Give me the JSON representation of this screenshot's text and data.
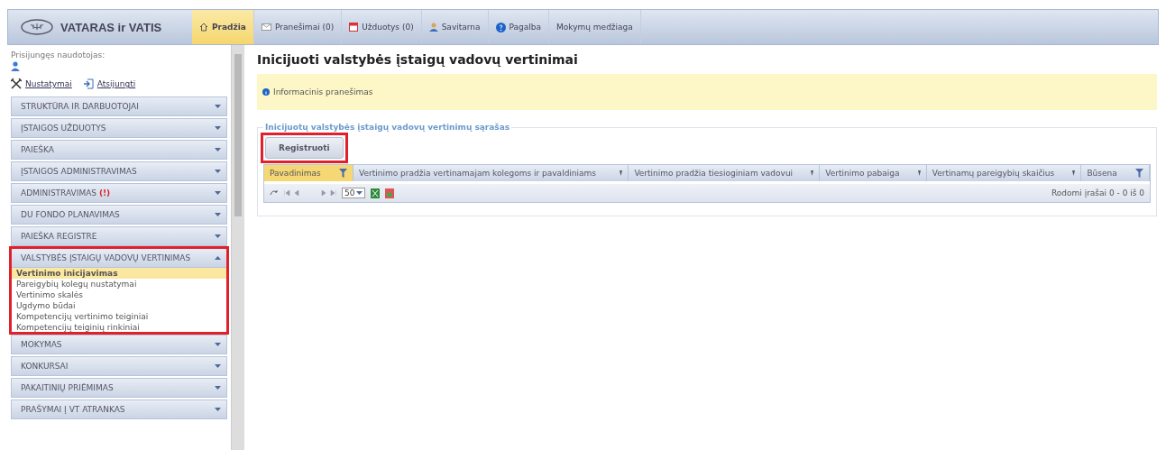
{
  "app": {
    "logo_text": "VATARAS ir VATIS"
  },
  "nav_tabs": [
    {
      "label": "Pradžia",
      "kind": "home",
      "selected": true
    },
    {
      "label": "Pranešimai (0)",
      "kind": "mail",
      "selected": false
    },
    {
      "label": "Užduotys (0)",
      "kind": "calendar",
      "selected": false
    },
    {
      "label": "Savitarna",
      "kind": "user",
      "selected": false
    },
    {
      "label": "Pagalba",
      "kind": "help",
      "selected": false
    },
    {
      "label": "Mokymų medžiaga",
      "kind": "plain",
      "selected": false
    }
  ],
  "user_panel": {
    "label": "Prisijungęs naudotojas:",
    "links": [
      {
        "label": "Nustatymai",
        "kind": "tools"
      },
      {
        "label": "Atsijungti",
        "kind": "logout"
      }
    ]
  },
  "sidebar": {
    "items": [
      {
        "label": "STRUKTŪRA IR DARBUOTOJAI",
        "expanded": false
      },
      {
        "label": "ĮSTAIGOS UŽDUOTYS",
        "expanded": false
      },
      {
        "label": "PAIEŠKA",
        "expanded": false
      },
      {
        "label": "ĮSTAIGOS ADMINISTRAVIMAS",
        "expanded": false
      },
      {
        "label": "ADMINISTRAVIMAS",
        "badge": "(!)",
        "expanded": false
      },
      {
        "label": "DU FONDO PLANAVIMAS",
        "expanded": false
      },
      {
        "label": "PAIEŠKA REGISTRE",
        "expanded": false
      },
      {
        "label": "VALSTYBĖS ĮSTAIGŲ VADOVŲ VERTINIMAS",
        "expanded": true,
        "highlighted": true,
        "children": [
          {
            "label": "Vertinimo inicijavimas",
            "selected": true
          },
          {
            "label": "Pareigybių kolegų nustatymai",
            "selected": false
          },
          {
            "label": "Vertinimo skalės",
            "selected": false
          },
          {
            "label": "Ugdymo būdai",
            "selected": false
          },
          {
            "label": "Kompetencijų vertinimo teiginiai",
            "selected": false
          },
          {
            "label": "Kompetencijų teiginių rinkiniai",
            "selected": false
          }
        ]
      },
      {
        "label": "MOKYMAS",
        "expanded": false
      },
      {
        "label": "KONKURSAI",
        "expanded": false
      },
      {
        "label": "PAKAITINIŲ PRIĖMIMAS",
        "expanded": false
      },
      {
        "label": "PRAŠYMAI Į VT ATRANKAS",
        "expanded": false
      }
    ]
  },
  "page": {
    "title": "Inicijuoti valstybės įstaigų vadovų vertinimai",
    "info_message": "Informacinis pranešimas",
    "list_legend": "Inicijuotų valstybės įstaigų vadovų vertinimų sąrašas",
    "register_button": {
      "label": "Registruoti",
      "highlighted": true
    },
    "table": {
      "columns": [
        {
          "label": "Pavadinimas",
          "selected": true,
          "filter": true
        },
        {
          "label": "Vertinimo pradžia vertinamajam kolegoms ir pavaldiniams",
          "selected": false,
          "filter": false
        },
        {
          "label": "Vertinimo pradžia tiesioginiam vadovui",
          "selected": false,
          "filter": false
        },
        {
          "label": "Vertinimo pabaiga",
          "selected": false,
          "filter": false
        },
        {
          "label": "Vertinamų pareigybių skaičius",
          "selected": false,
          "filter": false
        },
        {
          "label": "Būsena",
          "selected": false,
          "filter": true
        }
      ]
    },
    "pager": {
      "page_size": "50",
      "summary": "Rodomi įrašai 0 - 0 iš 0"
    }
  }
}
